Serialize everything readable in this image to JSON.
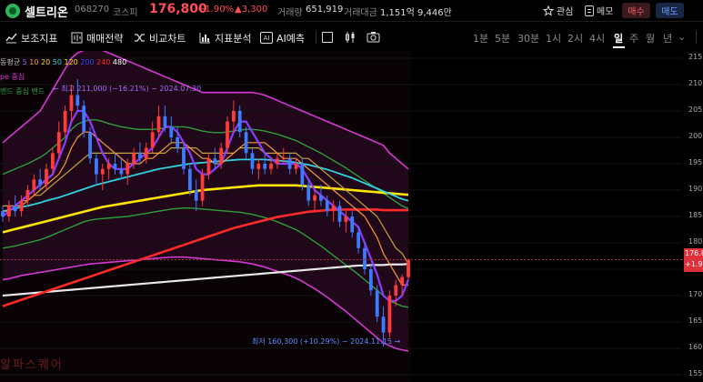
{
  "header": {
    "stock_name": "셀트리온",
    "stock_code": "068270",
    "market": "코스피",
    "price": "176,800",
    "change_pct": "+1.90%",
    "change_abs": "▲3,300",
    "volume_label": "거래량",
    "volume_value": "651,919",
    "amount_label": "거래대금",
    "amount_value": "1,151억 9,446만",
    "watch_label": "관심",
    "memo_label": "메모",
    "buy_label": "매수",
    "sell_label": "매도"
  },
  "toolbar": {
    "items": [
      "보조지표",
      "매매전략",
      "비교차트",
      "지표분석",
      "AI예측"
    ],
    "periods": [
      "1분",
      "5분",
      "30분",
      "1시",
      "2시",
      "4시",
      "일",
      "주",
      "월",
      "년"
    ],
    "active_period": "일",
    "period_more": "⌄"
  },
  "chart": {
    "legend_ma_label": "동평균",
    "legend_ma_periods": [
      "5",
      "10",
      "20",
      "50",
      "120",
      "200",
      "240",
      "480"
    ],
    "legend_ma_colors": [
      "#9b5cff",
      "#ff9a3c",
      "#ffd43b",
      "#33d1e0",
      "#ffe600",
      "#3344ff",
      "#ff2a2a",
      "#ffffff"
    ],
    "legend_envelope": "pe 중심",
    "legend_band": "밴드 중심 밴드",
    "high_annotation": "← 최고 211,000 (−16.21%) − 2024.07.30",
    "low_annotation": "최저 160,300 (+10.29%) − 2024.11.15 →",
    "y_ticks": [
      "215.0",
      "210.0",
      "205.0",
      "200.0",
      "195.0",
      "190.0",
      "185.0",
      "180.0",
      "176.8",
      "170.0",
      "165.0",
      "160.0",
      "155.0"
    ],
    "price_tag_price": "176.8",
    "price_tag_change": "+1.90",
    "watermark": "알파스퀘어"
  },
  "chart_data": {
    "type": "candlestick",
    "ylim": [
      155,
      215
    ],
    "y_ticks": [
      215,
      210,
      205,
      200,
      195,
      190,
      185,
      180,
      175,
      170,
      165,
      160,
      155
    ],
    "current_price": 176.8,
    "candles": [
      [
        186,
        187,
        184,
        185
      ],
      [
        185,
        188,
        184,
        187
      ],
      [
        187,
        189,
        185,
        186
      ],
      [
        186,
        189,
        185,
        188
      ],
      [
        188,
        191,
        187,
        190
      ],
      [
        190,
        193,
        189,
        192
      ],
      [
        192,
        194,
        190,
        191
      ],
      [
        191,
        195,
        190,
        194
      ],
      [
        194,
        198,
        193,
        197
      ],
      [
        197,
        203,
        196,
        201
      ],
      [
        201,
        206,
        200,
        205
      ],
      [
        205,
        210,
        203,
        208
      ],
      [
        208,
        211,
        205,
        206
      ],
      [
        206,
        207,
        200,
        201
      ],
      [
        201,
        202,
        195,
        196
      ],
      [
        196,
        197,
        191,
        193
      ],
      [
        193,
        195,
        190,
        194
      ],
      [
        194,
        196,
        192,
        195
      ],
      [
        195,
        197,
        193,
        194
      ],
      [
        194,
        196,
        192,
        193
      ],
      [
        193,
        196,
        191,
        195
      ],
      [
        195,
        198,
        194,
        197
      ],
      [
        197,
        199,
        195,
        196
      ],
      [
        196,
        199,
        195,
        198
      ],
      [
        198,
        203,
        197,
        201
      ],
      [
        201,
        206,
        200,
        204
      ],
      [
        204,
        206,
        201,
        202
      ],
      [
        202,
        204,
        199,
        200
      ],
      [
        200,
        202,
        197,
        198
      ],
      [
        198,
        199,
        193,
        194
      ],
      [
        194,
        195,
        189,
        190
      ],
      [
        190,
        192,
        186,
        188
      ],
      [
        188,
        194,
        187,
        193
      ],
      [
        193,
        197,
        192,
        196
      ],
      [
        196,
        198,
        194,
        195
      ],
      [
        195,
        199,
        194,
        198
      ],
      [
        198,
        204,
        197,
        203
      ],
      [
        203,
        207,
        201,
        205
      ],
      [
        205,
        206,
        200,
        201
      ],
      [
        201,
        202,
        196,
        197
      ],
      [
        197,
        198,
        193,
        194
      ],
      [
        194,
        196,
        192,
        195
      ],
      [
        195,
        197,
        193,
        194
      ],
      [
        194,
        196,
        193,
        195
      ],
      [
        195,
        197,
        194,
        196
      ],
      [
        196,
        198,
        195,
        196
      ],
      [
        196,
        197,
        193,
        194
      ],
      [
        194,
        196,
        193,
        195
      ],
      [
        195,
        196,
        190,
        191
      ],
      [
        191,
        192,
        187,
        188
      ],
      [
        188,
        190,
        186,
        189
      ],
      [
        189,
        191,
        187,
        188
      ],
      [
        188,
        189,
        185,
        186
      ],
      [
        186,
        188,
        184,
        187
      ],
      [
        187,
        188,
        183,
        184
      ],
      [
        184,
        186,
        182,
        185
      ],
      [
        185,
        186,
        181,
        182
      ],
      [
        182,
        183,
        178,
        179
      ],
      [
        179,
        180,
        174,
        175
      ],
      [
        175,
        176,
        170,
        171
      ],
      [
        171,
        172,
        165,
        166
      ],
      [
        166,
        168,
        160.3,
        163
      ],
      [
        163,
        171,
        162,
        170
      ],
      [
        170,
        173,
        168,
        172
      ],
      [
        172,
        174,
        170,
        173.5
      ],
      [
        173.5,
        177,
        173,
        176.8
      ]
    ],
    "ma_lines": [
      {
        "name": "5",
        "color": "#8b3dff",
        "values": [
          185,
          186,
          187,
          188,
          189,
          190,
          191,
          192,
          193,
          196,
          199,
          203,
          205,
          205,
          203,
          200,
          197,
          195,
          194,
          194,
          194,
          195,
          196,
          197,
          198,
          200,
          202,
          202,
          201,
          199,
          197,
          194,
          193,
          193,
          194,
          195,
          198,
          201,
          203,
          203,
          201,
          199,
          197,
          196,
          195,
          195,
          195,
          195,
          194,
          192,
          190,
          189,
          188,
          187,
          186,
          185,
          184,
          183,
          180,
          177,
          174,
          170,
          169,
          169,
          170,
          173
        ]
      },
      {
        "name": "10",
        "color": "#ff9a3c",
        "values": [
          186,
          186,
          187,
          187,
          188,
          189,
          190,
          191,
          192,
          193,
          195,
          198,
          200,
          201,
          201,
          200,
          199,
          198,
          197,
          196,
          195,
          195,
          195,
          196,
          196,
          197,
          198,
          199,
          199,
          199,
          198,
          197,
          196,
          196,
          195,
          195,
          196,
          197,
          198,
          199,
          199,
          199,
          199,
          198,
          197,
          196,
          196,
          196,
          195,
          194,
          193,
          192,
          191,
          190,
          189,
          188,
          187,
          186,
          185,
          183,
          181,
          178,
          176,
          174,
          172,
          172
        ]
      },
      {
        "name": "20",
        "color": "#c9a23a",
        "values": [
          187,
          187,
          187,
          188,
          188,
          189,
          189,
          190,
          191,
          192,
          193,
          194,
          195,
          196,
          197,
          197,
          197,
          197,
          197,
          197,
          197,
          197,
          197,
          197,
          197,
          197,
          197,
          198,
          198,
          198,
          198,
          198,
          197,
          197,
          197,
          197,
          197,
          197,
          198,
          198,
          198,
          198,
          197,
          197,
          197,
          197,
          197,
          197,
          196,
          196,
          195,
          194,
          193,
          192,
          191,
          190,
          189,
          188,
          187,
          186,
          185,
          183,
          181,
          179,
          178,
          176
        ]
      },
      {
        "name": "50",
        "color": "#33d1e0",
        "values": [
          186,
          186.2,
          186.5,
          186.8,
          187,
          187.3,
          187.6,
          188,
          188.3,
          188.6,
          189,
          189.4,
          189.8,
          190.2,
          190.6,
          191,
          191.3,
          191.6,
          191.9,
          192.2,
          192.5,
          192.8,
          193.1,
          193.4,
          193.7,
          194,
          194.2,
          194.4,
          194.6,
          194.8,
          195,
          195.1,
          195.2,
          195.3,
          195.4,
          195.5,
          195.6,
          195.7,
          195.8,
          195.8,
          195.8,
          195.8,
          195.8,
          195.7,
          195.6,
          195.5,
          195.4,
          195.2,
          195,
          194.8,
          194.5,
          194.2,
          193.9,
          193.5,
          193.1,
          192.7,
          192.3,
          191.8,
          191.3,
          190.8,
          190.3,
          189.8,
          189.3,
          188.8,
          188.3,
          188
        ]
      },
      {
        "name": "120",
        "color": "#ffe600",
        "values": [
          182,
          182.3,
          182.6,
          182.9,
          183.2,
          183.5,
          183.8,
          184.1,
          184.4,
          184.7,
          185,
          185.3,
          185.6,
          185.9,
          186.2,
          186.5,
          186.8,
          187,
          187.2,
          187.4,
          187.6,
          187.8,
          188,
          188.2,
          188.4,
          188.6,
          188.8,
          189,
          189.2,
          189.4,
          189.6,
          189.8,
          190,
          190.1,
          190.2,
          190.3,
          190.4,
          190.5,
          190.6,
          190.7,
          190.8,
          190.9,
          190.9,
          190.9,
          190.9,
          190.9,
          190.9,
          190.9,
          190.8,
          190.7,
          190.6,
          190.5,
          190.4,
          190.3,
          190.2,
          190.1,
          190,
          189.9,
          189.8,
          189.7,
          189.6,
          189.5,
          189.4,
          189.3,
          189.2,
          189.1
        ]
      },
      {
        "name": "240",
        "color": "#ff2a2a",
        "values": [
          168,
          168.4,
          168.8,
          169.2,
          169.6,
          170,
          170.4,
          170.8,
          171.2,
          171.6,
          172,
          172.4,
          172.8,
          173.2,
          173.6,
          174,
          174.4,
          174.8,
          175.2,
          175.6,
          176,
          176.4,
          176.8,
          177.2,
          177.6,
          178,
          178.4,
          178.8,
          179.2,
          179.6,
          180,
          180.4,
          180.8,
          181.2,
          181.6,
          182,
          182.4,
          182.8,
          183.1,
          183.4,
          183.7,
          184,
          184.3,
          184.6,
          184.9,
          185.1,
          185.3,
          185.5,
          185.7,
          185.9,
          186,
          186.1,
          186.2,
          186.3,
          186.3,
          186.3,
          186.3,
          186.3,
          186.3,
          186.3,
          186.3,
          186.2,
          186.2,
          186.2,
          186.2,
          186.2
        ]
      },
      {
        "name": "480",
        "color": "#e8e8e8",
        "values": [
          170,
          170.1,
          170.2,
          170.3,
          170.4,
          170.5,
          170.6,
          170.7,
          170.8,
          170.9,
          171,
          171.1,
          171.2,
          171.3,
          171.4,
          171.5,
          171.6,
          171.7,
          171.8,
          171.9,
          172,
          172.1,
          172.2,
          172.3,
          172.4,
          172.5,
          172.6,
          172.7,
          172.8,
          172.9,
          173,
          173.1,
          173.2,
          173.3,
          173.4,
          173.5,
          173.6,
          173.7,
          173.8,
          173.9,
          174,
          174.1,
          174.2,
          174.3,
          174.4,
          174.5,
          174.6,
          174.7,
          174.8,
          174.9,
          175,
          175.1,
          175.2,
          175.3,
          175.4,
          175.5,
          175.6,
          175.7,
          175.7,
          175.8,
          175.8,
          175.8,
          175.9,
          175.9,
          175.9,
          176
        ]
      }
    ],
    "band_upper": {
      "color": "#d638d6",
      "values": [
        199,
        200,
        201,
        202,
        203,
        204,
        205,
        207,
        209,
        211,
        213,
        215,
        216,
        216.5,
        217,
        217,
        216.5,
        216,
        215.5,
        215,
        214.5,
        214,
        213.5,
        213,
        212.5,
        212,
        211.5,
        211,
        210.5,
        210,
        209.5,
        209,
        208.5,
        208.5,
        208.5,
        208.5,
        208.5,
        208.5,
        208.5,
        208.5,
        208.5,
        208.3,
        208,
        207.5,
        207,
        206.5,
        206,
        205.5,
        205,
        204.5,
        204,
        203.5,
        203,
        202.5,
        202,
        201.5,
        201,
        200.5,
        200,
        199.5,
        199,
        198.5,
        197,
        196,
        195,
        194
      ]
    },
    "band_mid_upper": {
      "color": "#2e9e3a",
      "values": [
        193,
        193.5,
        194,
        194.5,
        195,
        195.6,
        196.2,
        197,
        198,
        199,
        200,
        201.5,
        202.5,
        203,
        203.3,
        203.3,
        203,
        202.6,
        202.3,
        202,
        201.8,
        201.6,
        201.5,
        201.5,
        201.5,
        201.6,
        201.8,
        202,
        202,
        202,
        201.8,
        201.5,
        201.2,
        201,
        200.9,
        200.9,
        201,
        201.2,
        201.4,
        201.5,
        201.5,
        201.4,
        201.2,
        200.9,
        200.6,
        200.2,
        199.8,
        199.4,
        198.8,
        198.2,
        197.6,
        197,
        196.3,
        195.6,
        194.9,
        194.2,
        193.4,
        192.6,
        191.8,
        191,
        190.2,
        189.4,
        188.6,
        187.8,
        187,
        186.5
      ]
    },
    "band_mid_lower": {
      "color": "#2e9e3a",
      "values": [
        179,
        179.2,
        179.4,
        179.7,
        180,
        180.3,
        180.6,
        181,
        181.5,
        182,
        182.5,
        183,
        183.5,
        184,
        184.3,
        184.5,
        184.6,
        184.7,
        184.8,
        184.9,
        185,
        185.2,
        185.4,
        185.6,
        185.8,
        186,
        186.2,
        186.4,
        186.5,
        186.6,
        186.6,
        186.5,
        186.4,
        186.3,
        186.2,
        186.1,
        186,
        185.9,
        185.8,
        185.6,
        185.4,
        185.1,
        184.8,
        184.4,
        184,
        183.5,
        183,
        182.5,
        181.8,
        181,
        180.2,
        179.4,
        178.5,
        177.6,
        176.7,
        175.8,
        174.9,
        174,
        173,
        172,
        171,
        170,
        169,
        168.5,
        168,
        167.8
      ]
    },
    "band_lower": {
      "color": "#d638d6",
      "values": [
        173,
        173.2,
        173.5,
        173.8,
        174,
        174.2,
        174.4,
        174.6,
        174.8,
        175,
        175.2,
        175.4,
        175.6,
        175.8,
        176,
        176.1,
        176.2,
        176.3,
        176.4,
        176.5,
        176.6,
        176.7,
        176.8,
        176.9,
        177,
        177.1,
        177.2,
        177.3,
        177.3,
        177.3,
        177.2,
        177.1,
        177,
        176.9,
        176.8,
        176.7,
        176.6,
        176.5,
        176.4,
        176.2,
        176,
        175.7,
        175.4,
        175,
        174.6,
        174.2,
        173.8,
        173.3,
        172.7,
        172,
        171.3,
        170.5,
        169.7,
        168.8,
        167.9,
        167,
        166,
        165,
        164,
        163,
        162,
        161,
        160.5,
        160,
        159.7,
        159.5
      ]
    }
  }
}
